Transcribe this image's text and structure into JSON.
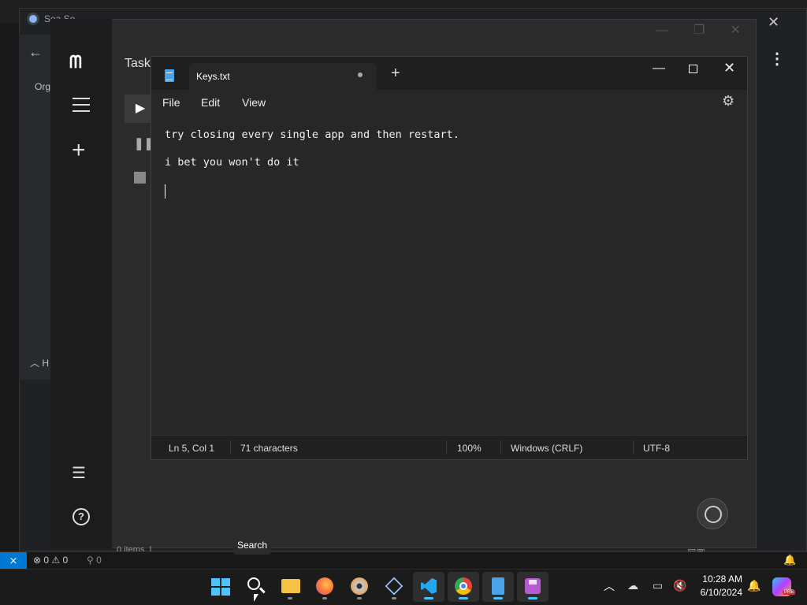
{
  "chrome": {
    "tab_title": "Sea  Se",
    "org_label": "Org",
    "section_label": "H"
  },
  "tasks_app": {
    "title": "Tasks",
    "items_count": "0 items",
    "tooltip": "Search"
  },
  "notepad": {
    "tab_title": "Keys.txt",
    "menu": [
      "File",
      "Edit",
      "View"
    ],
    "lines": [
      "try closing every single app and then restart.",
      "i bet you won't do it"
    ],
    "status": {
      "position": "Ln 5, Col 1",
      "characters": "71 characters",
      "zoom": "100%",
      "line_ending": "Windows (CRLF)",
      "encoding": "UTF-8"
    }
  },
  "vscode_status": {
    "errors": "0",
    "warnings": "0",
    "ports": "0"
  },
  "taskbar": {
    "apps": [
      {
        "name": "start",
        "icon": "windows-start-icon",
        "active": false
      },
      {
        "name": "search",
        "icon": "search-icon",
        "active": false
      },
      {
        "name": "file-explorer",
        "icon": "folder-icon",
        "active": false,
        "color": "#f6c243"
      },
      {
        "name": "firefox",
        "icon": "firefox-icon",
        "active": false,
        "color": "#ff7139"
      },
      {
        "name": "media-app",
        "icon": "disc-icon",
        "active": false,
        "color": "#c9c9c9"
      },
      {
        "name": "virtualbox",
        "icon": "cube-icon",
        "active": false,
        "color": "#9ecbff"
      },
      {
        "name": "vscode",
        "icon": "vscode-icon",
        "active": true,
        "color": "#22a7f0"
      },
      {
        "name": "chrome",
        "icon": "chrome-icon",
        "active": true,
        "color": "#4285f4"
      },
      {
        "name": "notepad",
        "icon": "notepad-icon",
        "active": true,
        "color": "#4aa3e8"
      },
      {
        "name": "app-purple",
        "icon": "floppy-icon",
        "active": true,
        "color": "#b55ad0"
      }
    ],
    "clock_time": "10:28 AM",
    "clock_date": "6/10/2024",
    "pre_badge": "PRE"
  },
  "colors": {
    "accent": "#4cc2ff",
    "vscode_remote": "#0078d4"
  }
}
